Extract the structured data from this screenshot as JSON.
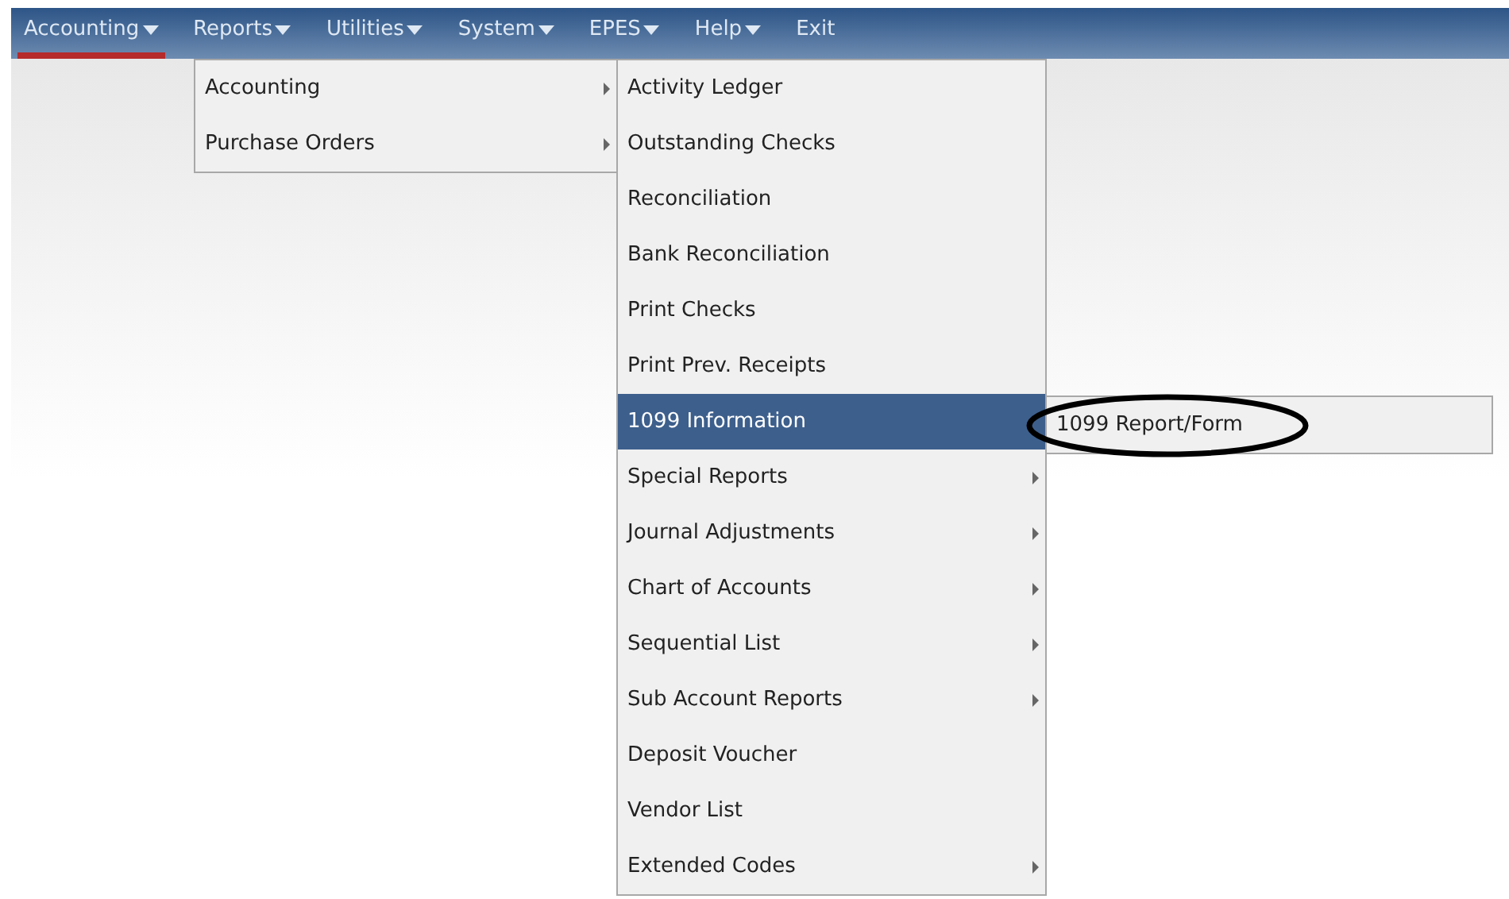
{
  "menubar": [
    {
      "label": "Accounting",
      "selected": true
    },
    {
      "label": "Reports",
      "selected": false
    },
    {
      "label": "Utilities",
      "selected": false
    },
    {
      "label": "System",
      "selected": false
    },
    {
      "label": "EPES",
      "selected": false
    },
    {
      "label": "Help",
      "selected": false
    },
    {
      "label": "Exit",
      "selected": false,
      "no_caret": true
    }
  ],
  "reports_menu": [
    {
      "label": "Accounting",
      "has_submenu": true,
      "selected": false
    },
    {
      "label": "Purchase Orders",
      "has_submenu": true,
      "selected": false
    }
  ],
  "accounting_menu": [
    {
      "label": "Activity Ledger",
      "has_submenu": false,
      "selected": false
    },
    {
      "label": "Outstanding Checks",
      "has_submenu": false,
      "selected": false
    },
    {
      "label": "Reconciliation",
      "has_submenu": false,
      "selected": false
    },
    {
      "label": "Bank Reconciliation",
      "has_submenu": false,
      "selected": false
    },
    {
      "label": "Print Checks",
      "has_submenu": false,
      "selected": false
    },
    {
      "label": "Print Prev. Receipts",
      "has_submenu": false,
      "selected": false
    },
    {
      "label": "1099 Information",
      "has_submenu": false,
      "selected": true
    },
    {
      "label": "Special Reports",
      "has_submenu": true,
      "selected": false
    },
    {
      "label": "Journal Adjustments",
      "has_submenu": true,
      "selected": false
    },
    {
      "label": "Chart of Accounts",
      "has_submenu": true,
      "selected": false
    },
    {
      "label": "Sequential List",
      "has_submenu": true,
      "selected": false
    },
    {
      "label": "Sub Account Reports",
      "has_submenu": true,
      "selected": false
    },
    {
      "label": "Deposit Voucher",
      "has_submenu": false,
      "selected": false
    },
    {
      "label": "Vendor List",
      "has_submenu": false,
      "selected": false
    },
    {
      "label": "Extended Codes",
      "has_submenu": true,
      "selected": false
    }
  ],
  "info_menu": [
    {
      "label": "1099 Report/Form",
      "circled": true
    }
  ]
}
